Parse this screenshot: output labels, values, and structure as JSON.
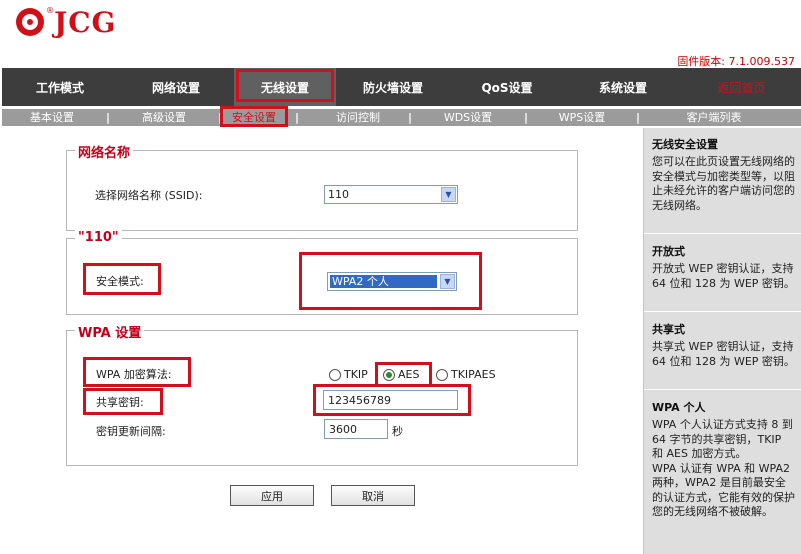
{
  "brand": {
    "name": "JCG",
    "reg": "®"
  },
  "firmware": "固件版本: 7.1.009.537",
  "mainnav": [
    {
      "label": "工作模式"
    },
    {
      "label": "网络设置"
    },
    {
      "label": "无线设置",
      "active": true
    },
    {
      "label": "防火墙设置"
    },
    {
      "label": "QoS设置"
    },
    {
      "label": "系统设置"
    },
    {
      "label": "返回首页"
    }
  ],
  "subnav": [
    {
      "label": "基本设置"
    },
    {
      "label": "高级设置"
    },
    {
      "label": "安全设置",
      "active": true
    },
    {
      "label": "访问控制"
    },
    {
      "label": "WDS设置"
    },
    {
      "label": "WPS设置"
    },
    {
      "label": "客户端列表"
    }
  ],
  "network": {
    "legend": "网络名称",
    "ssid_label": "选择网络名称 (SSID):",
    "ssid_value": "110"
  },
  "security": {
    "legend": "\"110\"",
    "mode_label": "安全模式:",
    "mode_value": "WPA2 个人"
  },
  "wpa": {
    "legend": "WPA 设置",
    "algo_label": "WPA 加密算法:",
    "options": [
      "TKIP",
      "AES",
      "TKIPAES"
    ],
    "selected": "AES",
    "key_label": "共享密钥:",
    "key_value": "123456789",
    "interval_label": "密钥更新间隔:",
    "interval_value": "3600",
    "interval_unit": "秒"
  },
  "buttons": {
    "apply": "应用",
    "cancel": "取消"
  },
  "sidebar": {
    "sections": [
      {
        "title": "无线安全设置",
        "text": "您可以在此页设置无线网络的安全模式与加密类型等，以阻止未经允许的客户端访问您的无线网络。"
      },
      {
        "title": "开放式",
        "text": "开放式 WEP 密钥认证，支持 64 位和 128 为 WEP 密钥。"
      },
      {
        "title": "共享式",
        "text": "共享式 WEP 密钥认证，支持 64 位和 128 为 WEP 密钥。"
      },
      {
        "title": "WPA 个人",
        "text": "WPA 个人认证方式支持 8 到 64 字节的共享密钥，TKIP 和 AES 加密方式。",
        "text2": "WPA 认证有 WPA 和 WPA2 两种，WPA2 是目前最安全的认证方式，它能有效的保护您的无线网络不被破解。"
      }
    ]
  },
  "colors": {
    "accent_red": "#d0101c",
    "nav_bg": "#3d3d3d",
    "subnav_bg": "#9b9b9b",
    "legend_red": "#c2001a"
  }
}
